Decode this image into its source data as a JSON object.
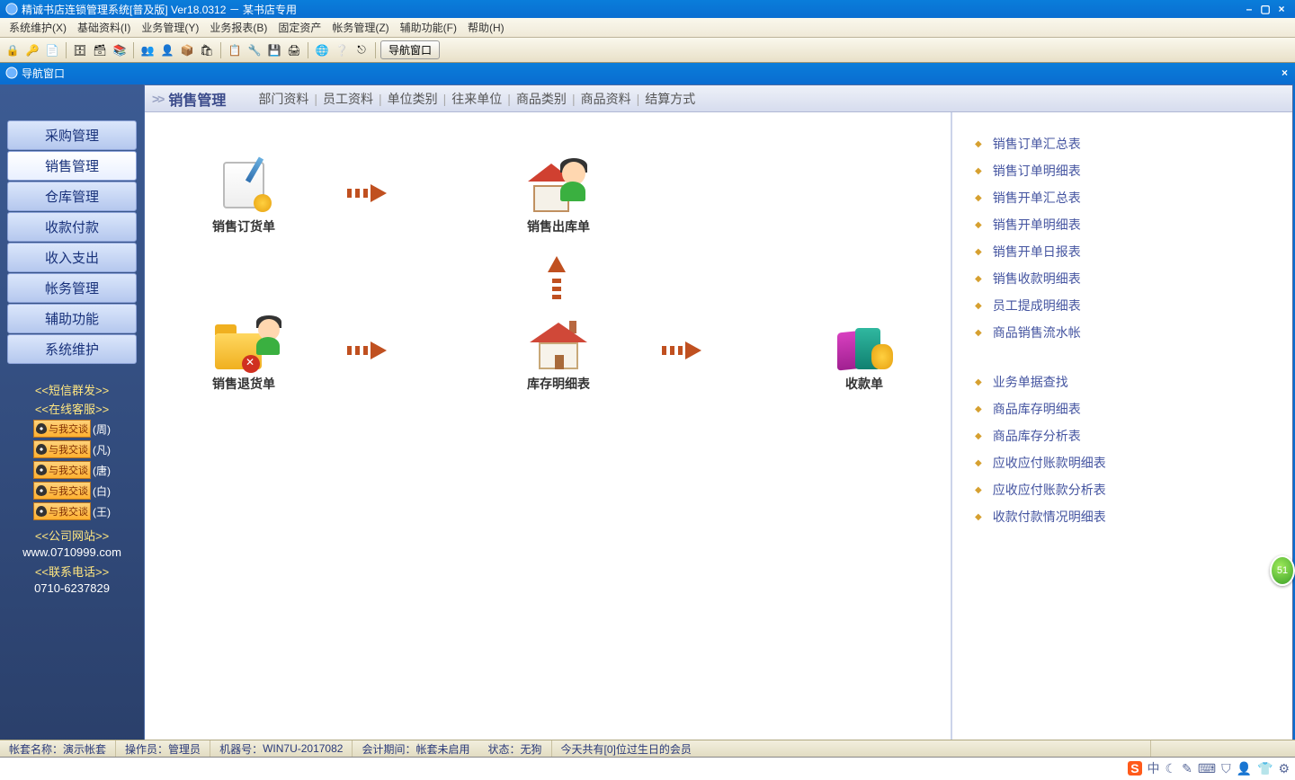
{
  "titlebar": {
    "title": "精诚书店连锁管理系统[普及版] Ver18.0312 － 某书店专用"
  },
  "menubar": [
    "系统维护(X)",
    "基础资料(I)",
    "业务管理(Y)",
    "业务报表(B)",
    "固定资产",
    "帐务管理(Z)",
    "辅助功能(F)",
    "帮助(H)"
  ],
  "toolbar": {
    "nav_button": "导航窗口"
  },
  "docbar": {
    "title": "导航窗口"
  },
  "sidebar": {
    "items": [
      "采购管理",
      "销售管理",
      "仓库管理",
      "收款付款",
      "收入支出",
      "帐务管理",
      "辅助功能",
      "系统维护"
    ],
    "active_index": 1,
    "sms_header": "<<短信群发>>",
    "service_header": "<<在线客服>>",
    "qq_label": "与我交谈",
    "qq_contacts": [
      "(周)",
      "(凡)",
      "(唐)",
      "(白)",
      "(王)"
    ],
    "site_header": "<<公司网站>>",
    "site_url": "www.0710999.com",
    "phone_header": "<<联系电话>>",
    "phone": "0710-6237829"
  },
  "content_header": {
    "marker": ">>",
    "title": "销售管理",
    "links": [
      "部门资料",
      "员工资料",
      "单位类别",
      "往来单位",
      "商品类别",
      "商品资料",
      "结算方式"
    ]
  },
  "flow": {
    "order": "销售订货单",
    "out": "销售出库单",
    "return": "销售退货单",
    "stock": "库存明细表",
    "receipt": "收款单"
  },
  "right_list_a": [
    "销售订单汇总表",
    "销售订单明细表",
    "销售开单汇总表",
    "销售开单明细表",
    "销售开单日报表",
    "销售收款明细表",
    "员工提成明细表",
    "商品销售流水帐"
  ],
  "right_list_b": [
    "业务单据查找",
    "商品库存明细表",
    "商品库存分析表",
    "应收应付账款明细表",
    "应收应付账款分析表",
    "收款付款情况明细表"
  ],
  "statusbar": {
    "account_label": "帐套名称：",
    "account_value": "演示帐套",
    "operator_label": "操作员：",
    "operator_value": "管理员",
    "machine_label": "机器号：",
    "machine_value": "WIN7U-2017082",
    "period_label": "会计期间：",
    "period_value": "帐套未启用",
    "state_label": "状态：",
    "state_value": "无狗",
    "birthday": "今天共有[0]位过生日的会员"
  },
  "float_badge": "51",
  "tray_items": [
    "S",
    "中",
    "☾",
    "✎",
    "⌨",
    "⛉",
    "👤",
    "👕",
    "⚙"
  ]
}
